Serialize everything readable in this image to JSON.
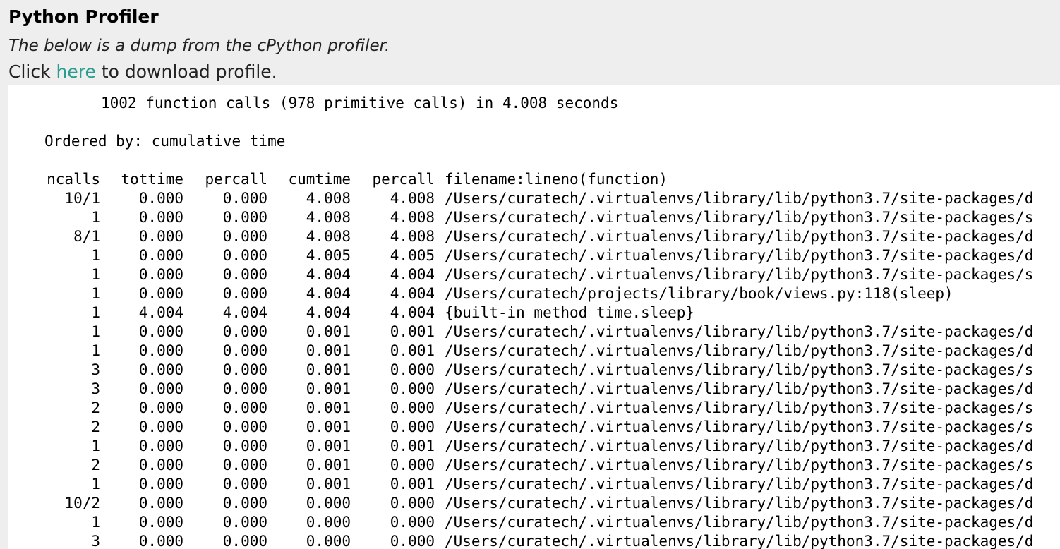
{
  "header": {
    "title": "Python Profiler",
    "subtitle": "The below is a dump from the cPython profiler.",
    "download_prefix": "Click ",
    "download_link": "here",
    "download_suffix": " to download profile."
  },
  "profile": {
    "summary": "1002 function calls (978 primitive calls) in 4.008 seconds",
    "ordered_by": "Ordered by: cumulative time",
    "columns": {
      "ncalls": "ncalls",
      "tottime": "tottime",
      "percall1": "percall",
      "cumtime": "cumtime",
      "percall2": "percall",
      "function": "filename:lineno(function)"
    },
    "rows": [
      {
        "ncalls": "10/1",
        "tottime": "0.000",
        "percall1": "0.000",
        "cumtime": "4.008",
        "percall2": "4.008",
        "function": "/Users/curatech/.virtualenvs/library/lib/python3.7/site-packages/d"
      },
      {
        "ncalls": "1",
        "tottime": "0.000",
        "percall1": "0.000",
        "cumtime": "4.008",
        "percall2": "4.008",
        "function": "/Users/curatech/.virtualenvs/library/lib/python3.7/site-packages/s"
      },
      {
        "ncalls": "8/1",
        "tottime": "0.000",
        "percall1": "0.000",
        "cumtime": "4.008",
        "percall2": "4.008",
        "function": "/Users/curatech/.virtualenvs/library/lib/python3.7/site-packages/d"
      },
      {
        "ncalls": "1",
        "tottime": "0.000",
        "percall1": "0.000",
        "cumtime": "4.005",
        "percall2": "4.005",
        "function": "/Users/curatech/.virtualenvs/library/lib/python3.7/site-packages/d"
      },
      {
        "ncalls": "1",
        "tottime": "0.000",
        "percall1": "0.000",
        "cumtime": "4.004",
        "percall2": "4.004",
        "function": "/Users/curatech/.virtualenvs/library/lib/python3.7/site-packages/s"
      },
      {
        "ncalls": "1",
        "tottime": "0.000",
        "percall1": "0.000",
        "cumtime": "4.004",
        "percall2": "4.004",
        "function": "/Users/curatech/projects/library/book/views.py:118(sleep)"
      },
      {
        "ncalls": "1",
        "tottime": "4.004",
        "percall1": "4.004",
        "cumtime": "4.004",
        "percall2": "4.004",
        "function": "{built-in method time.sleep}"
      },
      {
        "ncalls": "1",
        "tottime": "0.000",
        "percall1": "0.000",
        "cumtime": "0.001",
        "percall2": "0.001",
        "function": "/Users/curatech/.virtualenvs/library/lib/python3.7/site-packages/d"
      },
      {
        "ncalls": "1",
        "tottime": "0.000",
        "percall1": "0.000",
        "cumtime": "0.001",
        "percall2": "0.001",
        "function": "/Users/curatech/.virtualenvs/library/lib/python3.7/site-packages/d"
      },
      {
        "ncalls": "3",
        "tottime": "0.000",
        "percall1": "0.000",
        "cumtime": "0.001",
        "percall2": "0.000",
        "function": "/Users/curatech/.virtualenvs/library/lib/python3.7/site-packages/s"
      },
      {
        "ncalls": "3",
        "tottime": "0.000",
        "percall1": "0.000",
        "cumtime": "0.001",
        "percall2": "0.000",
        "function": "/Users/curatech/.virtualenvs/library/lib/python3.7/site-packages/d"
      },
      {
        "ncalls": "2",
        "tottime": "0.000",
        "percall1": "0.000",
        "cumtime": "0.001",
        "percall2": "0.000",
        "function": "/Users/curatech/.virtualenvs/library/lib/python3.7/site-packages/s"
      },
      {
        "ncalls": "2",
        "tottime": "0.000",
        "percall1": "0.000",
        "cumtime": "0.001",
        "percall2": "0.000",
        "function": "/Users/curatech/.virtualenvs/library/lib/python3.7/site-packages/s"
      },
      {
        "ncalls": "1",
        "tottime": "0.000",
        "percall1": "0.000",
        "cumtime": "0.001",
        "percall2": "0.001",
        "function": "/Users/curatech/.virtualenvs/library/lib/python3.7/site-packages/d"
      },
      {
        "ncalls": "2",
        "tottime": "0.000",
        "percall1": "0.000",
        "cumtime": "0.001",
        "percall2": "0.000",
        "function": "/Users/curatech/.virtualenvs/library/lib/python3.7/site-packages/s"
      },
      {
        "ncalls": "1",
        "tottime": "0.000",
        "percall1": "0.000",
        "cumtime": "0.001",
        "percall2": "0.001",
        "function": "/Users/curatech/.virtualenvs/library/lib/python3.7/site-packages/d"
      },
      {
        "ncalls": "10/2",
        "tottime": "0.000",
        "percall1": "0.000",
        "cumtime": "0.000",
        "percall2": "0.000",
        "function": "/Users/curatech/.virtualenvs/library/lib/python3.7/site-packages/d"
      },
      {
        "ncalls": "1",
        "tottime": "0.000",
        "percall1": "0.000",
        "cumtime": "0.000",
        "percall2": "0.000",
        "function": "/Users/curatech/.virtualenvs/library/lib/python3.7/site-packages/d"
      },
      {
        "ncalls": "3",
        "tottime": "0.000",
        "percall1": "0.000",
        "cumtime": "0.000",
        "percall2": "0.000",
        "function": "/Users/curatech/.virtualenvs/library/lib/python3.7/site-packages/d"
      }
    ]
  }
}
